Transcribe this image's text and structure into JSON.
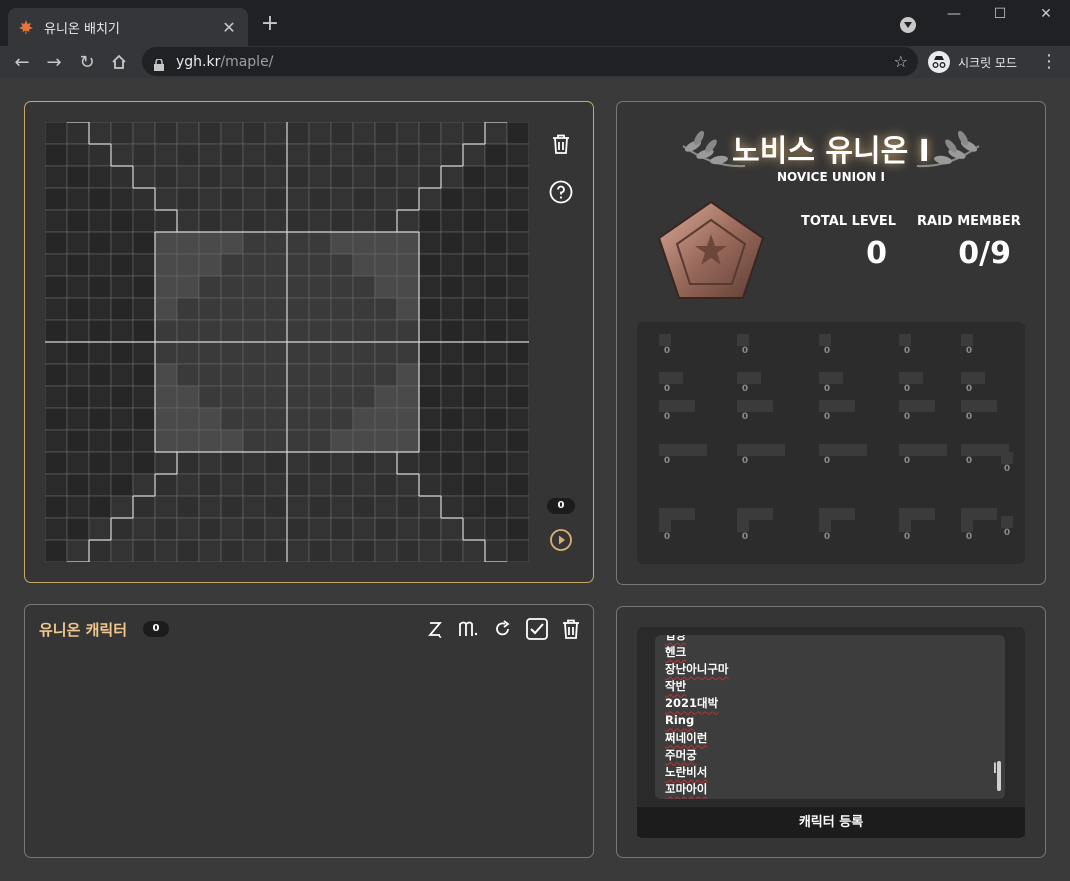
{
  "browser": {
    "tab_title": "유니온 배치기",
    "url_host": "ygh.kr",
    "url_path": "/maple/",
    "incognito_label": "시크릿 모드",
    "icons": [
      "maple-leaf-icon",
      "close-icon",
      "plus-icon",
      "back-icon",
      "forward-icon",
      "reload-icon",
      "home-icon",
      "lock-icon",
      "star-icon",
      "incognito-icon",
      "menu-icon"
    ]
  },
  "board": {
    "placed_count": "0",
    "icons": [
      "trash-icon",
      "help-icon",
      "play-icon"
    ]
  },
  "union": {
    "rank_title": "노비스 유니온 I",
    "rank_subtitle": "NOVICE UNION I",
    "total_level_label": "TOTAL LEVEL",
    "total_level_value": "0",
    "raid_member_label": "RAID MEMBER",
    "raid_member_value": "0/9",
    "block_counts": [
      "0",
      "0",
      "0",
      "0",
      "0",
      "0",
      "0",
      "0",
      "0",
      "0",
      "0",
      "0",
      "0",
      "0",
      "0",
      "0",
      "0",
      "0",
      "0",
      "0",
      "0",
      "0",
      "0",
      "0",
      "0",
      "0",
      "0"
    ]
  },
  "characters": {
    "title": "유니온 캐릭터",
    "count": "0",
    "tools": [
      "sort-level-icon",
      "sort-class-icon",
      "refresh-icon",
      "check-all-icon",
      "trash-icon"
    ]
  },
  "register": {
    "names": [
      "닙앙",
      "헨크",
      "장난아니구마",
      "작반",
      "2021대박",
      "Ring",
      "쩌네이런",
      "주머궁",
      "노란비서",
      "꼬마아이"
    ],
    "button_label": "캐릭터 등록"
  }
}
